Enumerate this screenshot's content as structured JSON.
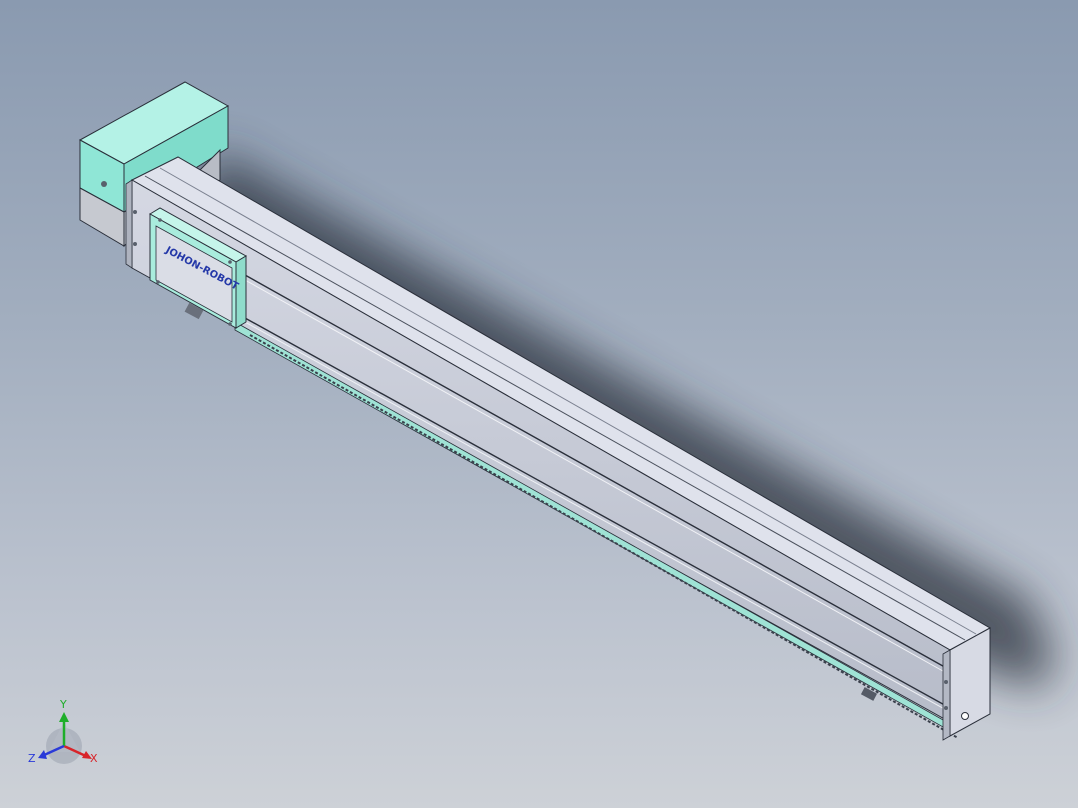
{
  "viewport": {
    "background_top": "#8a9ab0",
    "background_bottom": "#cdd1d7"
  },
  "model": {
    "carriage_logo": "JOHON-ROBOT",
    "colors": {
      "motor_housing": "#8fe6d6",
      "rail_body": "#c9cdd8",
      "rail_top": "#dde0ea",
      "carriage_plate": "#a9ecdd",
      "edge": "#2a2f3a",
      "shadow": "#2c333d"
    }
  },
  "triad": {
    "x_label": "X",
    "y_label": "Y",
    "z_label": "Z",
    "x_color": "#d8242a",
    "y_color": "#1fae2a",
    "z_color": "#2a3ad8"
  }
}
